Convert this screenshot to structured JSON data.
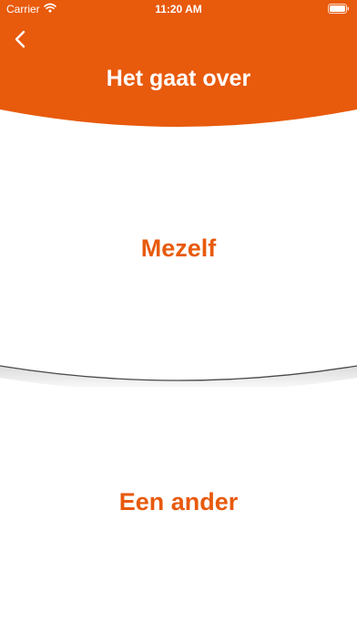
{
  "status_bar": {
    "carrier": "Carrier",
    "time": "11:20 AM",
    "icons": [
      "wifi-icon",
      "battery-icon"
    ]
  },
  "header": {
    "title": "Het gaat over",
    "back_icon": "chevron-left-icon"
  },
  "options": [
    {
      "label": "Mezelf"
    },
    {
      "label": "Een ander"
    }
  ],
  "colors": {
    "accent": "#e85a0c",
    "background": "#ffffff",
    "header_text": "#ffffff"
  }
}
